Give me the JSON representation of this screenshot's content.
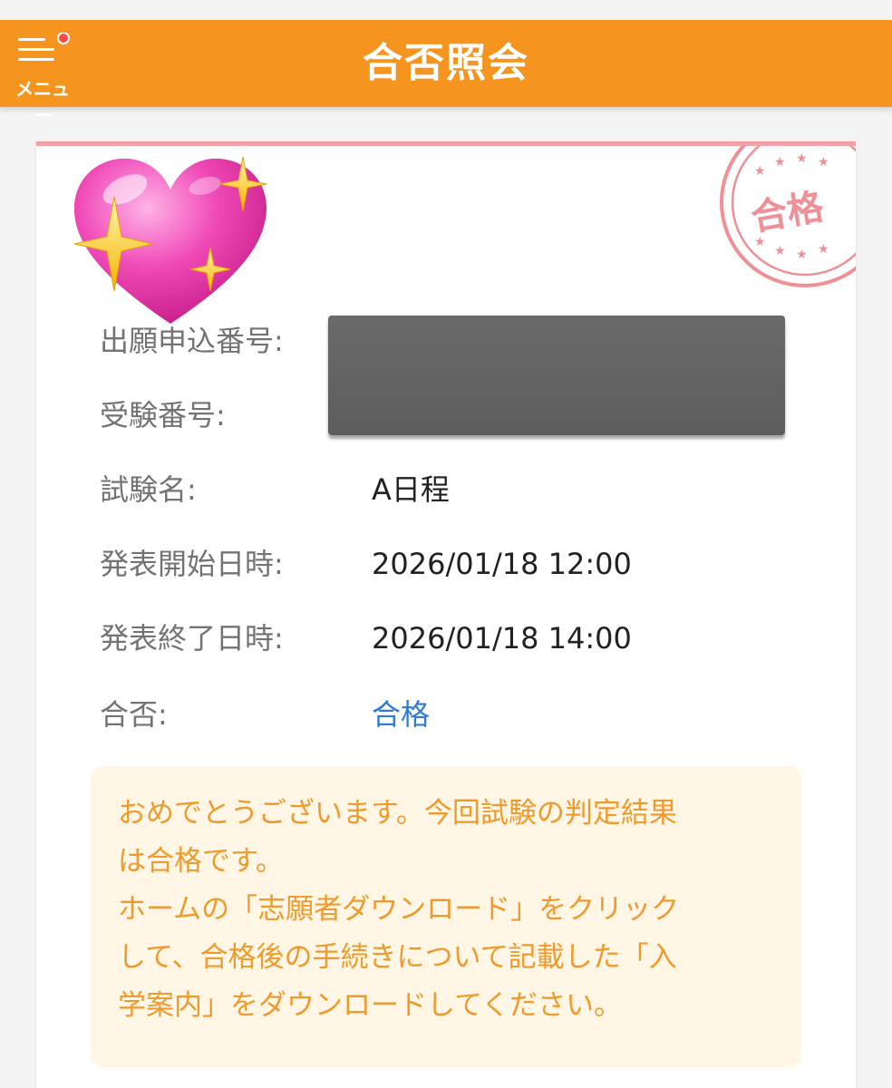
{
  "header": {
    "title": "合否照会",
    "menu_label": "メニュー"
  },
  "card": {
    "stamp_text": "合格",
    "fields": [
      {
        "label": "出願申込番号:",
        "value": ""
      },
      {
        "label": "受験番号:",
        "value": ""
      },
      {
        "label": "試験名:",
        "value": "A日程"
      },
      {
        "label": "発表開始日時:",
        "value": "2026/01/18 12:00"
      },
      {
        "label": "発表終了日時:",
        "value": "2026/01/18 14:00"
      },
      {
        "label": "合否:",
        "value": "合格"
      }
    ],
    "notice_lines": [
      "おめでとうございます。今回試験の判定結果",
      "は合格です。",
      "ホームの「志願者ダウンロード」をクリック",
      "して、合格後の手続きについて記載した「入",
      "学案内」をダウンロードしてください。"
    ]
  },
  "colors": {
    "header_bg": "#f5951f",
    "card_top_border": "#f2a0a6",
    "stamp": "#ef8f96",
    "pass_value": "#2f7bd6",
    "notice_bg": "#fff6e6",
    "notice_text": "#ef9a2c"
  },
  "icons": [
    "hamburger-menu-icon",
    "notification-dot-icon",
    "sparkling-heart-icon",
    "pass-stamp-icon"
  ]
}
